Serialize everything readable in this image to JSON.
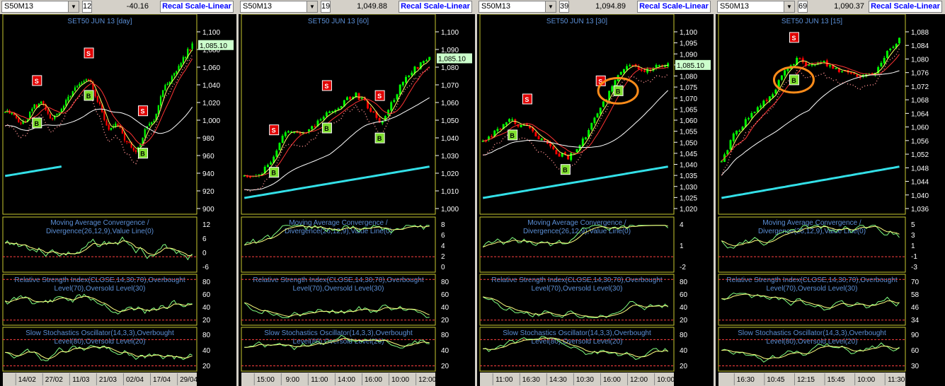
{
  "panels": [
    {
      "symbol": "S50M13",
      "count": "12",
      "change": "-40.16",
      "recal": "Recal Scale-Linear",
      "title": "SET50 JUN 13   [day]",
      "price_label": "1,085.10",
      "price_ticks": [
        "1,100",
        "1,080",
        "1,060",
        "1,040",
        "1,020",
        "1,000",
        "980",
        "960",
        "940",
        "920",
        "900"
      ],
      "macd_title": [
        "Moving Average Convergence /",
        "Divergence(26,12,9),Value Line(0)"
      ],
      "macd_ticks": [
        "12",
        "6",
        "0",
        "-6"
      ],
      "rsi_title": [
        "Relative Strength Index(CLOSE,14,30,70),Overbought",
        "Level(70),Oversold Level(30)"
      ],
      "rsi_ticks": [
        "80",
        "60",
        "40",
        "20"
      ],
      "sto_title": [
        "Slow Stochastics Oscillator(14,3,3),Overbought",
        "Level(80),Oversold Level(20)"
      ],
      "sto_ticks": [
        "80",
        "40",
        "20"
      ],
      "x_labels": [
        "14/02",
        "27/02",
        "11/03",
        "21/03",
        "02/04",
        "17/04",
        "29/04"
      ],
      "signals": [
        {
          "type": "S",
          "label": "S"
        },
        {
          "type": "S",
          "label": "S"
        },
        {
          "type": "S",
          "label": "S"
        },
        {
          "type": "B",
          "label": "B"
        },
        {
          "type": "B",
          "label": "B"
        },
        {
          "type": "B",
          "label": "B"
        }
      ]
    },
    {
      "symbol": "S50M13",
      "count": "19",
      "change": "1,049.88",
      "recal": "Recal Scale-Linear",
      "title": "SET50 JUN 13   [60]",
      "price_label": "1,085.10",
      "price_ticks": [
        "1,100",
        "1,090",
        "1,080",
        "1,070",
        "1,060",
        "1,050",
        "1,040",
        "1,030",
        "1,020",
        "1,010",
        "1,000"
      ],
      "macd_title": [
        "Moving Average Convergence /",
        "Divergence(26,12,9),Value Line(0)"
      ],
      "macd_ticks": [
        "8",
        "6",
        "4",
        "2",
        "0"
      ],
      "rsi_title": [
        "Relative Strength Index(CLOSE,14,30,70),Overbought",
        "Level(70),Oversold Level(30)"
      ],
      "rsi_ticks": [
        "80",
        "60",
        "40",
        "20"
      ],
      "sto_title": [
        "Slow Stochastics Oscillator(14,3,3),Overbought",
        "Level(80),Oversold Level(20)"
      ],
      "sto_ticks": [
        "80",
        "40",
        "20"
      ],
      "x_labels": [
        "15:00",
        "9:00",
        "11:00",
        "14:00",
        "16:00",
        "10:00",
        "12:00"
      ],
      "signals": [
        {
          "type": "S",
          "label": "S"
        },
        {
          "type": "S",
          "label": "S"
        },
        {
          "type": "S",
          "label": "S"
        },
        {
          "type": "B",
          "label": "B"
        },
        {
          "type": "B",
          "label": "B"
        },
        {
          "type": "B",
          "label": "B"
        }
      ]
    },
    {
      "symbol": "S50M13",
      "count": "39",
      "change": "1,094.89",
      "recal": "Recal Scale-Linear",
      "title": "SET50 JUN 13   [30]",
      "price_label": "1,085.10",
      "price_ticks": [
        "1,100",
        "1,095",
        "1,090",
        "1,085",
        "1,080",
        "1,075",
        "1,070",
        "1,065",
        "1,060",
        "1,055",
        "1,050",
        "1,045",
        "1,040",
        "1,035",
        "1,030",
        "1,025",
        "1,020"
      ],
      "macd_title": [
        "Moving Average Convergence /",
        "Divergence(26,12,9),Value Line(0)"
      ],
      "macd_ticks": [
        "4",
        "1",
        "-2"
      ],
      "rsi_title": [
        "Relative Strength Index(CLOSE,14,30,70),Overbought",
        "Level(70),Oversold Level(30)"
      ],
      "rsi_ticks": [
        "80",
        "60",
        "40",
        "20"
      ],
      "sto_title": [
        "Slow Stochastics Oscillator(14,3,3),Overbought",
        "Level(80),Oversold Level(20)"
      ],
      "sto_ticks": [
        "80",
        "40",
        "20"
      ],
      "x_labels": [
        "11:00",
        "16:30",
        "14:30",
        "10:30",
        "16:00",
        "12:00",
        "10:00"
      ],
      "signals": [
        {
          "type": "S",
          "label": "S"
        },
        {
          "type": "S",
          "label": "S"
        },
        {
          "type": "B",
          "label": "B"
        },
        {
          "type": "B",
          "label": "B"
        },
        {
          "type": "B",
          "label": "B"
        }
      ]
    },
    {
      "symbol": "S50M13",
      "count": "69",
      "change": "1,090.37",
      "recal": "Recal Scale-Linear",
      "title": "SET50 JUN 13   [15]",
      "price_label": "",
      "price_ticks": [
        "1,088",
        "1,084",
        "1,080",
        "1,076",
        "1,072",
        "1,068",
        "1,064",
        "1,060",
        "1,056",
        "1,052",
        "1,048",
        "1,044",
        "1,040",
        "1,036"
      ],
      "macd_title": [
        "Moving Average Convergence /",
        "Divergence(26,12,9),Value Line(0)"
      ],
      "macd_ticks": [
        "5",
        "3",
        "1",
        "-1",
        "-3"
      ],
      "rsi_title": [
        "Relative Strength Index(CLOSE,14,30,70),Overbought",
        "Level(70),Oversold Level(30)"
      ],
      "rsi_ticks": [
        "70",
        "58",
        "46",
        "34"
      ],
      "sto_title": [
        "Slow Stochastics Oscillator(14,3,3),Overbought",
        "Level(80),Oversold Level(20)"
      ],
      "sto_ticks": [
        "90",
        "60",
        "30"
      ],
      "x_labels": [
        "16:30",
        "10:45",
        "12:15",
        "15:45",
        "10:00",
        "11:30"
      ],
      "signals": [
        {
          "type": "S",
          "label": "S"
        },
        {
          "type": "B",
          "label": "B"
        }
      ]
    }
  ],
  "chart_data": [
    {
      "type": "line",
      "title": "SET50 JUN 13   [day]",
      "series": [
        {
          "name": "",
          "values": [
            1010,
            1005,
            995,
            1015,
            1020,
            1000,
            1010,
            1030,
            1040,
            1045,
            1020,
            990,
            995,
            975,
            965,
            990,
            1000,
            1040,
            1050,
            1070,
            1085
          ]
        }
      ],
      "ylim": [
        900,
        1100
      ]
    },
    {
      "type": "line",
      "title": "SET50 JUN 13   [60]",
      "series": [
        {
          "name": "",
          "values": [
            1020,
            1018,
            1025,
            1040,
            1045,
            1042,
            1050,
            1055,
            1060,
            1065,
            1058,
            1048,
            1060,
            1075,
            1080,
            1085
          ]
        }
      ],
      "ylim": [
        1000,
        1100
      ]
    },
    {
      "type": "line",
      "title": "SET50 JUN 13   [30]",
      "series": [
        {
          "name": "",
          "values": [
            1050,
            1055,
            1060,
            1058,
            1055,
            1050,
            1045,
            1043,
            1050,
            1060,
            1070,
            1080,
            1085,
            1082,
            1084,
            1085
          ]
        }
      ],
      "ylim": [
        1020,
        1100
      ]
    },
    {
      "type": "line",
      "title": "SET50 JUN 13   [15]",
      "series": [
        {
          "name": "",
          "values": [
            1050,
            1058,
            1062,
            1066,
            1070,
            1076,
            1080,
            1078,
            1079,
            1077,
            1076,
            1075,
            1076,
            1082,
            1086
          ]
        }
      ],
      "ylim": [
        1036,
        1088
      ]
    }
  ],
  "colors": {
    "bull": "#00ff00",
    "bear": "#ff0000",
    "fast_ma": "#ffff66",
    "mid_ma": "#ff3333",
    "slow_ma": "#ffffff",
    "long_ma": "#33e0e8",
    "accent": "#ff8c1a",
    "text": "#5b8fd6"
  }
}
